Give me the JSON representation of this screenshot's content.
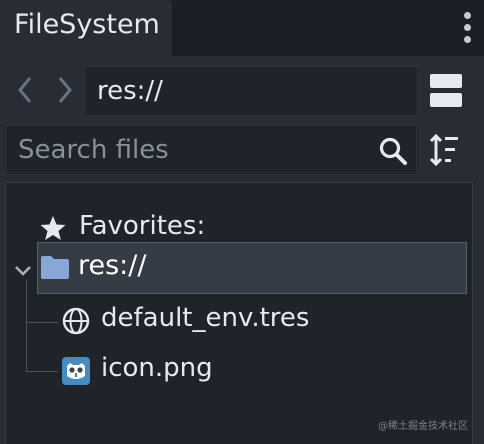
{
  "tab": {
    "title": "FileSystem"
  },
  "toolbar": {
    "path": "res://",
    "back_icon": "chevron-left-icon",
    "forward_icon": "chevron-right-icon",
    "split_icon": "split-view-icon"
  },
  "search": {
    "placeholder": "Search files",
    "icon": "search-icon",
    "sort_icon": "sort-icon"
  },
  "tree": {
    "favorites_label": "Favorites:",
    "root": {
      "label": "res://",
      "expanded": true,
      "selected": true
    },
    "items": [
      {
        "label": "default_env.tres",
        "icon": "globe-icon"
      },
      {
        "label": "icon.png",
        "icon": "godot-logo-icon"
      }
    ]
  },
  "watermark": "@稀土掘金技术社区",
  "colors": {
    "background": "#21262e",
    "panel": "#272c35",
    "field": "#1f232a",
    "selection": "#363c46",
    "folder": "#88a7d6",
    "text": "#e6e9ee"
  }
}
